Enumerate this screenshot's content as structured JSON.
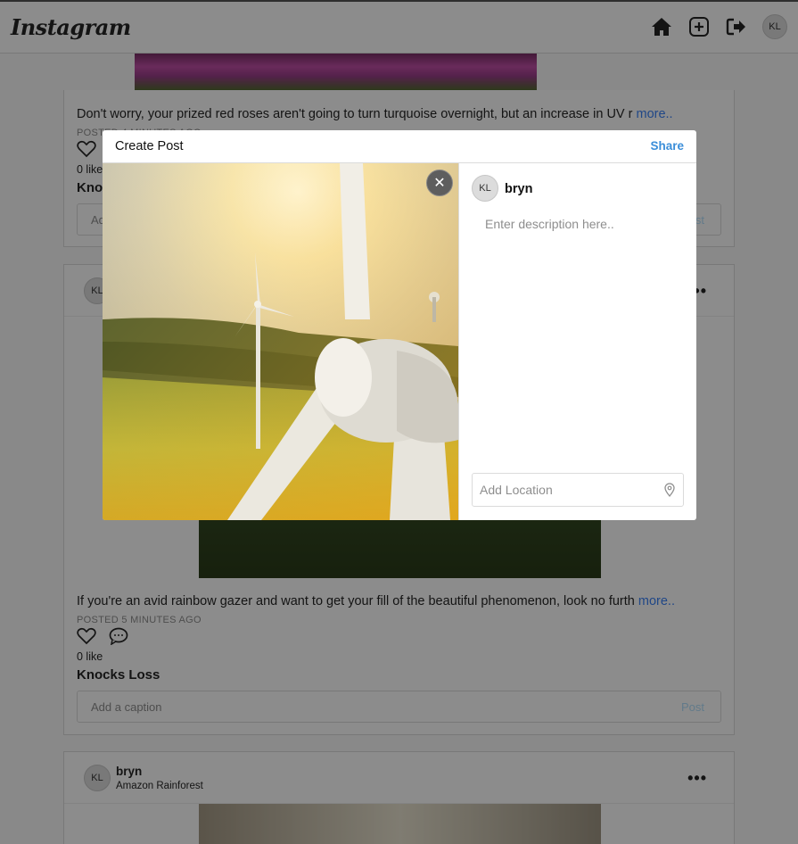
{
  "nav": {
    "logo": "Instagram",
    "avatar_initials": "KL",
    "icons": [
      "home-icon",
      "add-post-icon",
      "logout-icon"
    ]
  },
  "feed": {
    "post1": {
      "caption": "Don't worry, your prized red roses aren't going to turn turquoise overnight, but an increase in UV r",
      "more": "more..",
      "posted": "POSTED 4 MINUTES AGO",
      "likes": "0 like",
      "author": "Knocks Loss",
      "comment_placeholder": "Add a caption",
      "post_label": "Post"
    },
    "post2": {
      "avatar_initials": "KL",
      "caption": "If you're an avid rainbow gazer and want to get your fill of the beautiful phenomenon, look no furth",
      "more": "more..",
      "posted": "POSTED 5 MINUTES AGO",
      "likes": "0 like",
      "author": "Knocks Loss",
      "comment_placeholder": "Add a caption",
      "post_label": "Post"
    },
    "post3": {
      "avatar_initials": "KL",
      "username": "bryn",
      "location": "Amazon Rainforest",
      "menu": "•••"
    }
  },
  "modal": {
    "title": "Create Post",
    "share_label": "Share",
    "close_glyph": "✕",
    "avatar_initials": "KL",
    "username": "bryn",
    "description_placeholder": "Enter description here..",
    "location_placeholder": "Add Location"
  },
  "colors": {
    "accent": "#3b8ed9",
    "link": "#3b82f6",
    "overlay": "rgba(0,0,0,0.45)"
  }
}
